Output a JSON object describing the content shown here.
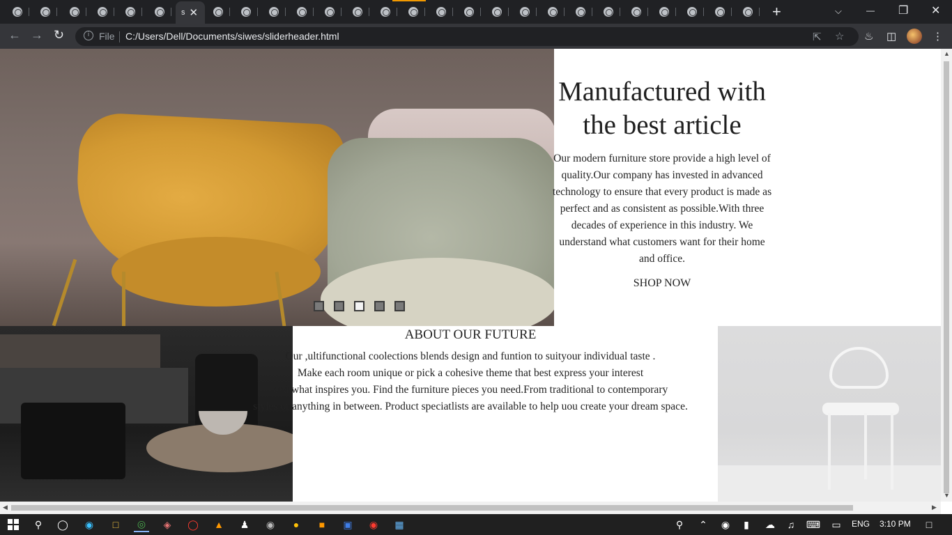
{
  "browser": {
    "active_tab": {
      "label": "s",
      "close": "✕"
    },
    "new_tab": "+",
    "window_controls": {
      "list": "⌵",
      "minimize": "—",
      "restore": "❐",
      "close": "✕"
    },
    "address": {
      "scheme_label": "File",
      "url": "C:/Users/Dell/Documents/siwes/sliderheader.html"
    }
  },
  "hero": {
    "title_line1": "Manufactured with",
    "title_line2": "the best article",
    "body_lines": [
      "Our modern furniture store provide a high level of",
      "quality.Our company has invested in advanced",
      "technology to ensure that every product is made as",
      "perfect and as consistent as possible.With three",
      "decades of experience in this industry. We",
      "understand what customers want for their home",
      "and office."
    ],
    "cta": "SHOP NOW",
    "slides": 5,
    "active_slide": 3
  },
  "about": {
    "title": "ABOUT OUR FUTURE",
    "body_lines": [
      "Our ,ultifunctional coolections blends design and funtion to suityour individual taste .",
      "Make each room unique or pick a cohesive theme that best express your interest",
      "and what inspires you. Find the furniture pieces you need.From traditional to contemporary",
      "styles or anything in between. Product speciatlists are available to help uou create your dream space."
    ]
  },
  "taskbar": {
    "language": "ENG",
    "time": "3:10 PM"
  },
  "colors": {
    "chrome_dark": "#202124",
    "chrome_toolbar": "#35363a",
    "taskbar": "#202020"
  }
}
